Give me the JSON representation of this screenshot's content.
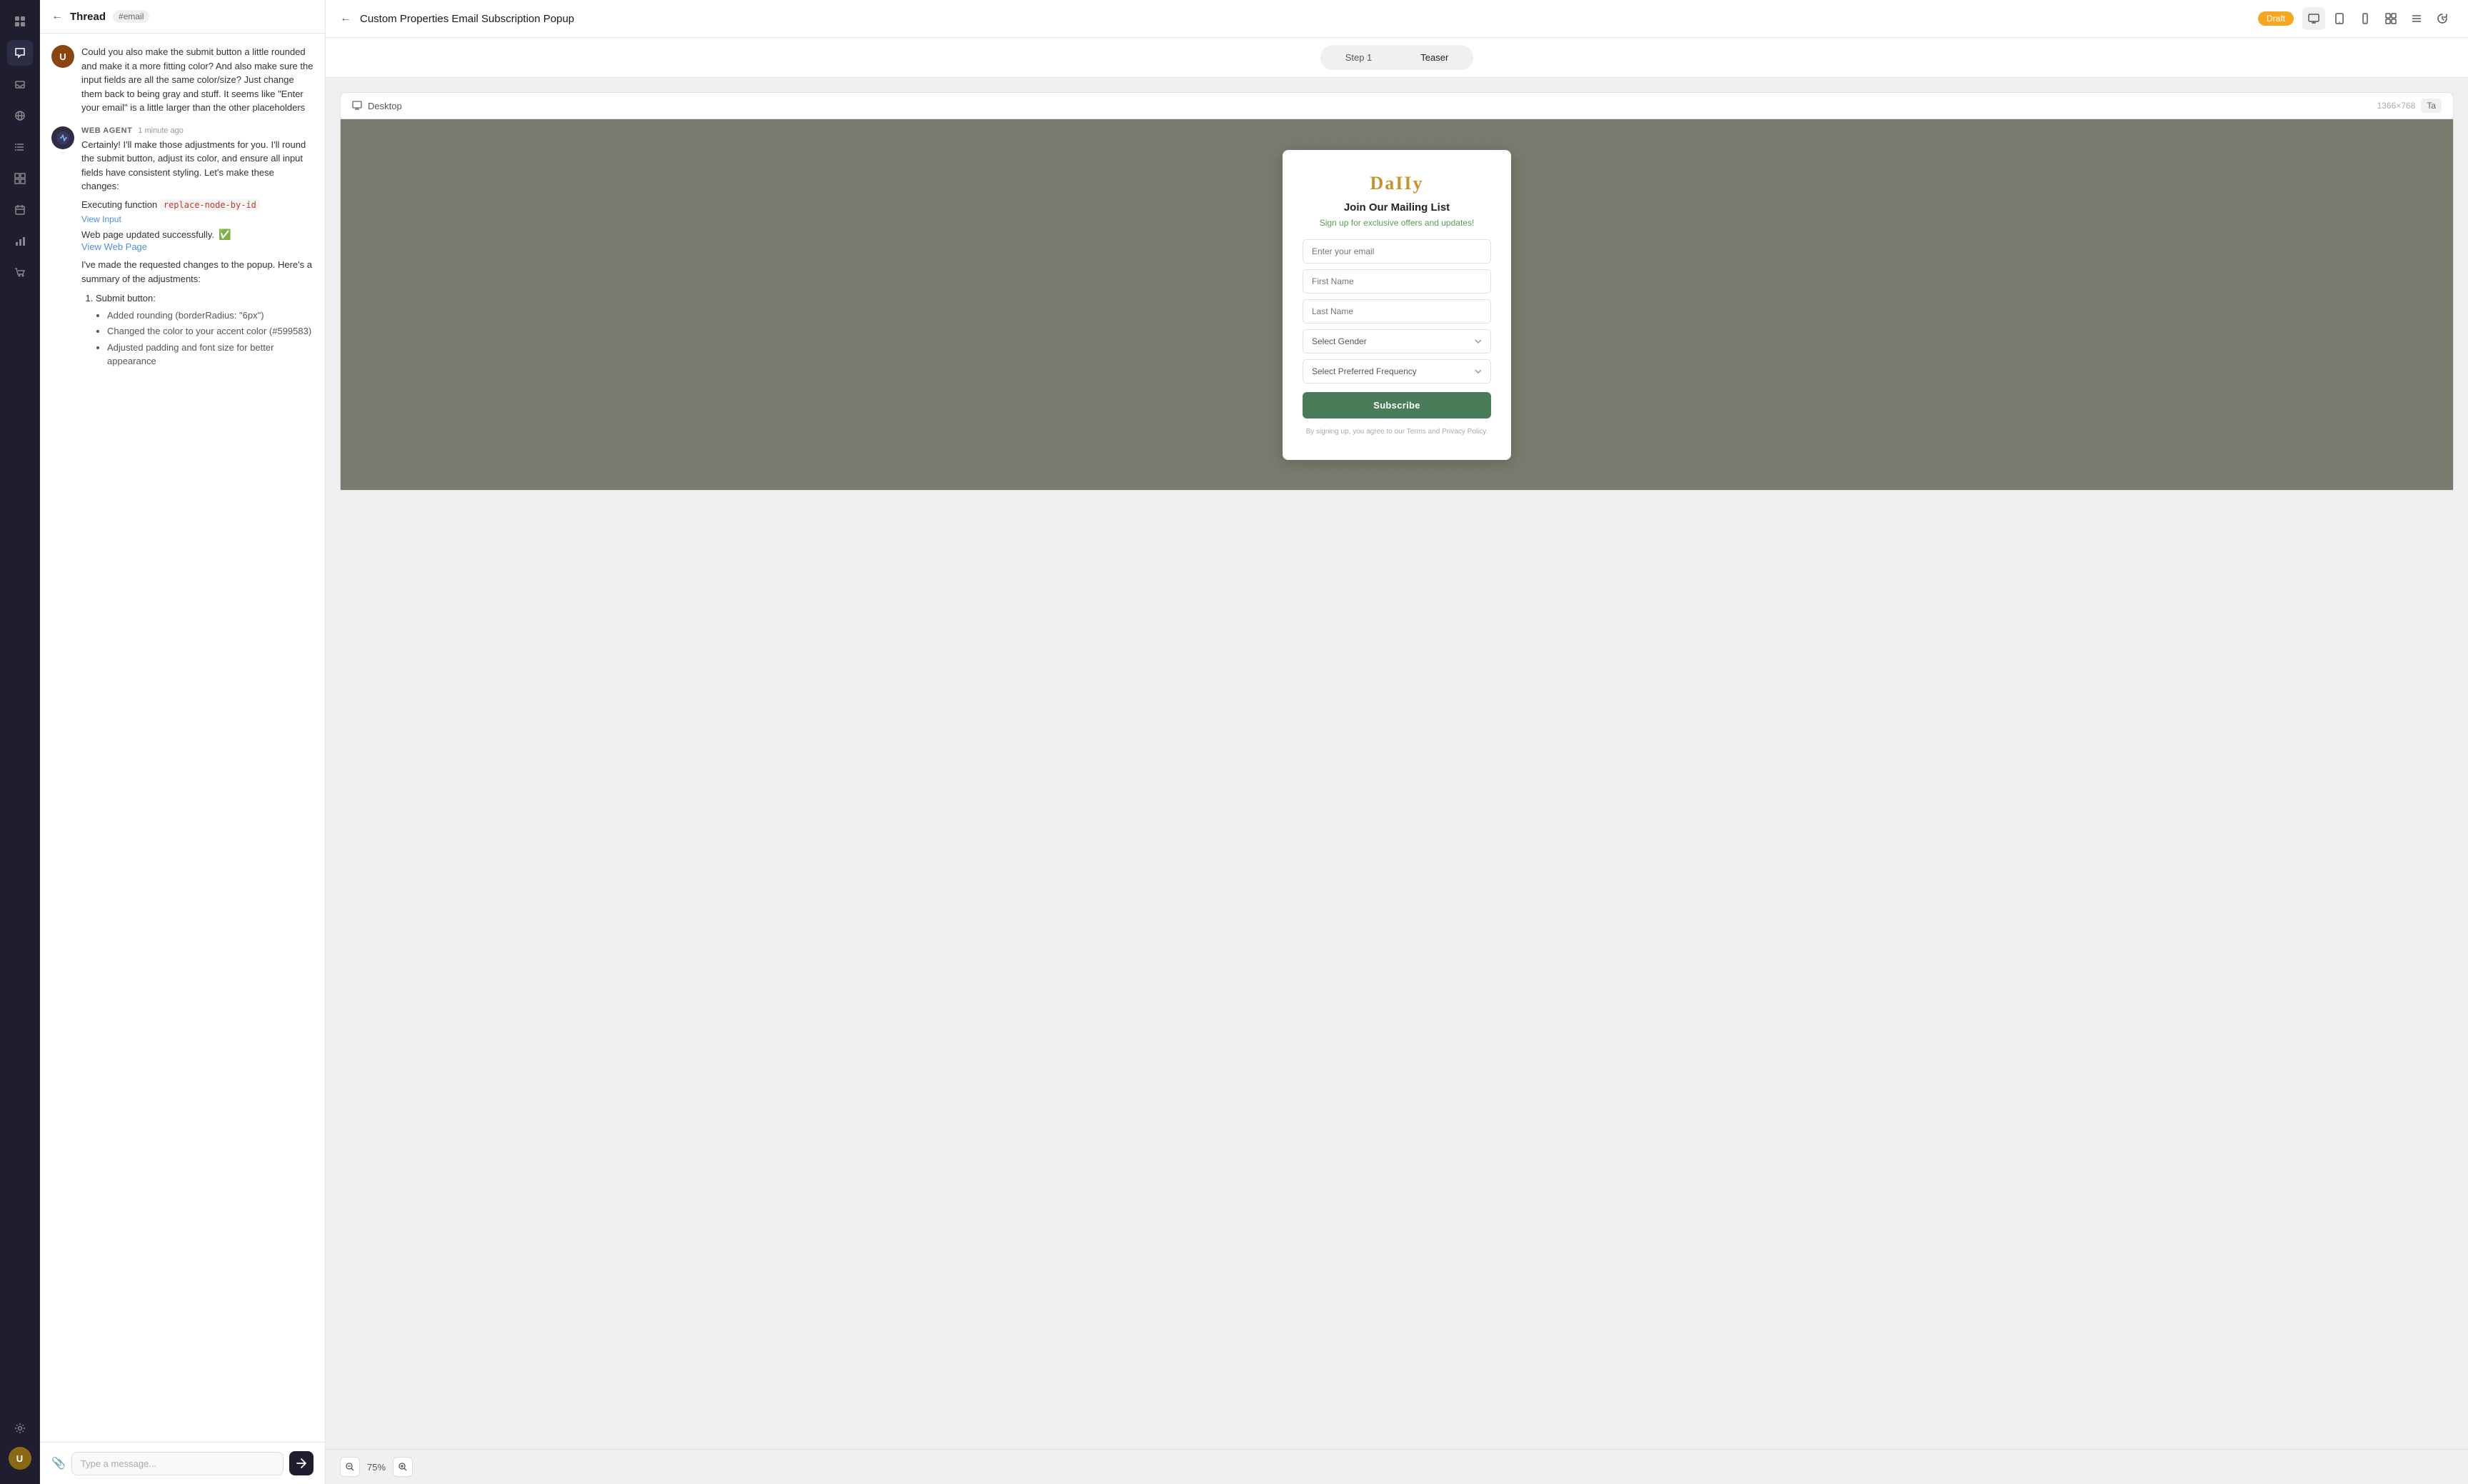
{
  "iconBar": {
    "icons": [
      {
        "name": "panel-icon",
        "symbol": "⊞"
      },
      {
        "name": "chat-icon",
        "symbol": "💬"
      },
      {
        "name": "inbox-icon",
        "symbol": "📥"
      },
      {
        "name": "globe-icon",
        "symbol": "🌐"
      },
      {
        "name": "list-icon",
        "symbol": "☰"
      },
      {
        "name": "grid-icon",
        "symbol": "⊞"
      },
      {
        "name": "calendar-icon",
        "symbol": "📅"
      },
      {
        "name": "chart-icon",
        "symbol": "📊"
      },
      {
        "name": "cart-icon",
        "symbol": "🛒"
      },
      {
        "name": "settings-icon",
        "symbol": "⚙"
      }
    ]
  },
  "thread": {
    "header": {
      "title": "Thread",
      "tag": "#email",
      "back_label": "←"
    },
    "messages": [
      {
        "type": "user",
        "text": "Could you also make the submit button a little rounded and make it a more fitting color? And also make sure the input fields are all the same color/size? Just change them back to being gray and stuff. It seems like \"Enter your email\" is a little larger than the other placeholders"
      },
      {
        "type": "agent",
        "sender": "WEB AGENT",
        "time": "1 minute ago",
        "body_text": "Certainly! I'll make those adjustments for you. I'll round the submit button, adjust its color, and ensure all input fields have consistent styling. Let's make these changes:",
        "executing": "Executing function",
        "function_name": "replace-node-by-id",
        "view_input": "View Input",
        "success": "Web page updated successfully.",
        "view_link": "View Web Page",
        "summary": "I've made the requested changes to the popup. Here's a summary of the adjustments:",
        "bullets": [
          {
            "label": "Submit button:",
            "sub": [
              "Added rounding (borderRadius: \"6px\")",
              "Changed the color to your accent color (#599583)",
              "Adjusted padding and font size for better appearance"
            ]
          }
        ]
      }
    ],
    "input": {
      "placeholder": "Type a message...",
      "attach_icon": "📎",
      "send_icon": "➤"
    }
  },
  "editor": {
    "header": {
      "back_label": "←",
      "title": "Custom Properties Email Subscription Popup",
      "draft_label": "Draft",
      "icons": [
        "desktop",
        "tablet",
        "mobile",
        "grid",
        "menu",
        "history"
      ]
    },
    "tabs": [
      {
        "label": "Step 1",
        "active": false
      },
      {
        "label": "Teaser",
        "active": true
      }
    ],
    "deviceBar": {
      "icon": "🖥",
      "label": "Desktop",
      "resolution": "1366×768",
      "tab_label": "Ta"
    },
    "popup": {
      "logo": "DaIIy",
      "title": "Join Our Mailing List",
      "subtitle": "Sign up for exclusive offers and updates!",
      "fields": [
        {
          "placeholder": "Enter your email",
          "type": "input"
        },
        {
          "placeholder": "First Name",
          "type": "input"
        },
        {
          "placeholder": "Last Name",
          "type": "input"
        },
        {
          "placeholder": "Select Gender",
          "type": "select"
        },
        {
          "placeholder": "Select Preferred Frequency",
          "type": "select"
        }
      ],
      "subscribe_label": "Subscribe",
      "terms": "By signing up, you agree to our Terms and Privacy Policy."
    },
    "zoom": {
      "level": "75%",
      "zoom_in": "+",
      "zoom_out": "−"
    }
  }
}
